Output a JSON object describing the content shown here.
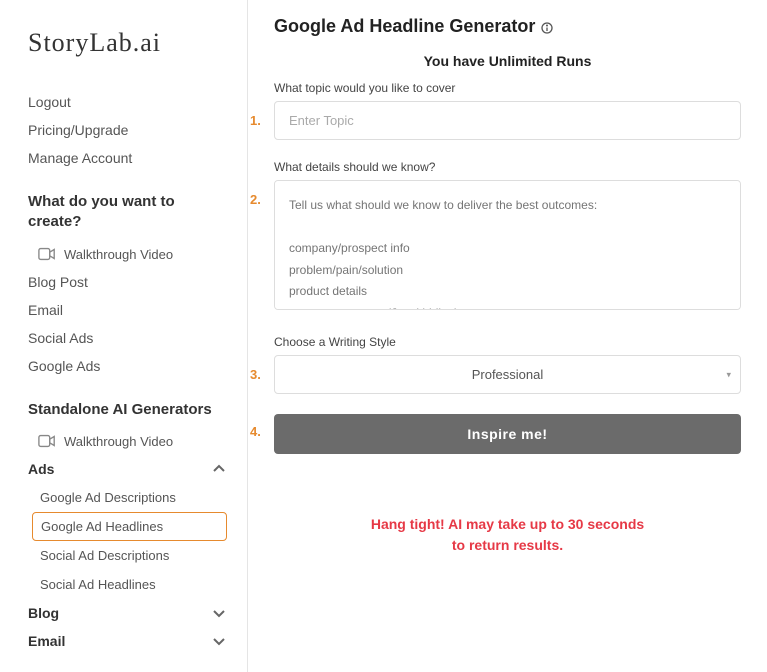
{
  "brand": "StoryLab.ai",
  "account_links": {
    "logout": "Logout",
    "pricing": "Pricing/Upgrade",
    "manage": "Manage Account"
  },
  "create_section": {
    "heading": "What do you want to create?",
    "walkthrough": "Walkthrough Video",
    "items": [
      "Blog Post",
      "Email",
      "Social Ads",
      "Google Ads"
    ]
  },
  "standalone_section": {
    "heading": "Standalone AI Generators",
    "walkthrough": "Walkthrough Video",
    "ads": {
      "label": "Ads",
      "items": [
        "Google Ad Descriptions",
        "Google Ad Headlines",
        "Social Ad Descriptions",
        "Social Ad Headlines"
      ]
    },
    "blog": {
      "label": "Blog"
    },
    "email": {
      "label": "Email"
    }
  },
  "main": {
    "title": "Google Ad Headline Generator",
    "runs_banner": "You have Unlimited Runs",
    "steps": [
      "1.",
      "2.",
      "3.",
      "4."
    ],
    "field1": {
      "label": "What topic would you like to cover",
      "placeholder": "Enter Topic"
    },
    "field2": {
      "label": "What details should we know?",
      "placeholder": "Tell us what should we know to deliver the best outcomes:\n\ncompany/prospect info\nproblem/pain/solution\nproduct details\nyour secret sauce (Just kidding)"
    },
    "field3": {
      "label": "Choose a Writing Style",
      "selected": "Professional"
    },
    "button": "Inspire me!",
    "wait_msg": "Hang tight! AI may take up to 30 seconds\nto return results."
  }
}
